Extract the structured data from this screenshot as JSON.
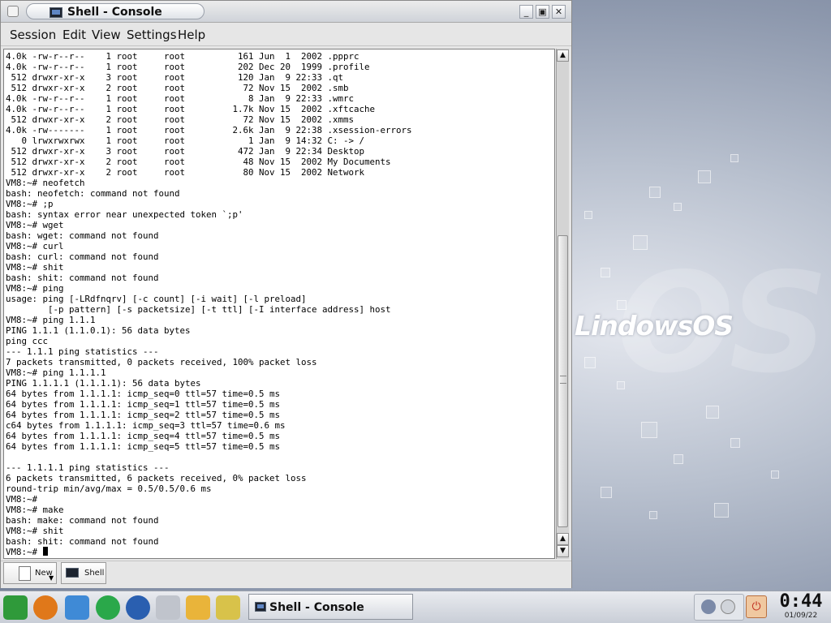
{
  "window": {
    "title": "Shell - Console",
    "buttons": {
      "minimize": "_",
      "maximize": "▣",
      "close": "✕"
    }
  },
  "menu": [
    "Session",
    "Edit",
    "View",
    "Settings",
    "Help"
  ],
  "terminal": {
    "lines": [
      "4.0k -rw-r--r--    1 root     root          161 Jun  1  2002 .ppprc",
      "4.0k -rw-r--r--    1 root     root          202 Dec 20  1999 .profile",
      " 512 drwxr-xr-x    3 root     root          120 Jan  9 22:33 .qt",
      " 512 drwxr-xr-x    2 root     root           72 Nov 15  2002 .smb",
      "4.0k -rw-r--r--    1 root     root            8 Jan  9 22:33 .wmrc",
      "4.0k -rw-r--r--    1 root     root         1.7k Nov 15  2002 .xftcache",
      " 512 drwxr-xr-x    2 root     root           72 Nov 15  2002 .xmms",
      "4.0k -rw-------    1 root     root         2.6k Jan  9 22:38 .xsession-errors",
      "   0 lrwxrwxrwx    1 root     root            1 Jan  9 14:32 C: -> /",
      " 512 drwxr-xr-x    3 root     root          472 Jan  9 22:34 Desktop",
      " 512 drwxr-xr-x    2 root     root           48 Nov 15  2002 My Documents",
      " 512 drwxr-xr-x    2 root     root           80 Nov 15  2002 Network",
      "VM8:~# neofetch",
      "bash: neofetch: command not found",
      "VM8:~# ;p",
      "bash: syntax error near unexpected token `;p'",
      "VM8:~# wget",
      "bash: wget: command not found",
      "VM8:~# curl",
      "bash: curl: command not found",
      "VM8:~# shit",
      "bash: shit: command not found",
      "VM8:~# ping",
      "usage: ping [-LRdfnqrv] [-c count] [-i wait] [-l preload]",
      "        [-p pattern] [-s packetsize] [-t ttl] [-I interface address] host",
      "VM8:~# ping 1.1.1",
      "PING 1.1.1 (1.1.0.1): 56 data bytes",
      "ping ccc",
      "--- 1.1.1 ping statistics ---",
      "7 packets transmitted, 0 packets received, 100% packet loss",
      "VM8:~# ping 1.1.1.1",
      "PING 1.1.1.1 (1.1.1.1): 56 data bytes",
      "64 bytes from 1.1.1.1: icmp_seq=0 ttl=57 time=0.5 ms",
      "64 bytes from 1.1.1.1: icmp_seq=1 ttl=57 time=0.5 ms",
      "64 bytes from 1.1.1.1: icmp_seq=2 ttl=57 time=0.5 ms",
      "c64 bytes from 1.1.1.1: icmp_seq=3 ttl=57 time=0.6 ms",
      "64 bytes from 1.1.1.1: icmp_seq=4 ttl=57 time=0.5 ms",
      "64 bytes from 1.1.1.1: icmp_seq=5 ttl=57 time=0.5 ms",
      "",
      "--- 1.1.1.1 ping statistics ---",
      "6 packets transmitted, 6 packets received, 0% packet loss",
      "round-trip min/avg/max = 0.5/0.5/0.6 ms",
      "VM8:~#",
      "VM8:~# make",
      "bash: make: command not found",
      "VM8:~# shit",
      "bash: shit: command not found",
      "VM8:~# "
    ]
  },
  "tabs": {
    "new_label": "New",
    "shell_label": "Shell"
  },
  "desktop": {
    "logo_text": "LindowsOS"
  },
  "taskbar": {
    "task_label": "Shell - Console",
    "launchers": [
      "lindows-icon",
      "lifebuoy-icon",
      "package-icon",
      "runner-icon",
      "globe-icon",
      "drive-icon",
      "swimmer-icon",
      "pen-icon"
    ],
    "clock_time": "0:44",
    "clock_date": "01/09/22"
  },
  "colors": {
    "accent": "#5f86c4",
    "terminal_bg": "#ffffff",
    "terminal_fg": "#000000"
  }
}
